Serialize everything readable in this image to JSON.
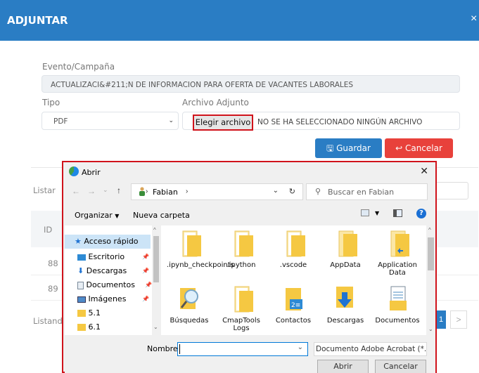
{
  "modal": {
    "title": "ADJUNTAR",
    "close": "×"
  },
  "form": {
    "evento_label": "Evento/Campaña",
    "evento_value": "ACTUALIZACI&#211;N DE INFORMACION PARA OFERTA DE VACANTES LABORALES",
    "tipo_label": "Tipo",
    "tipo_value": "PDF",
    "archivo_label": "Archivo Adjunto",
    "choose_file": "Elegir archivo",
    "no_file": "NO SE HA SELECCIONADO NINGÚN ARCHIVO",
    "save": "Guardar",
    "cancel": "Cancelar"
  },
  "background": {
    "listar": "Listar",
    "id_header": "ID",
    "rows": [
      "88",
      "89"
    ],
    "listando": "Listand",
    "page": "1",
    "next": ">"
  },
  "dialog": {
    "title": "Abrir",
    "close": "✕",
    "path_folder": "Fabian",
    "search_placeholder": "Buscar en Fabian",
    "organize": "Organizar",
    "new_folder": "Nueva carpeta",
    "nav_items": [
      {
        "label": "Acceso rápido"
      },
      {
        "label": "Escritorio"
      },
      {
        "label": "Descargas"
      },
      {
        "label": "Documentos"
      },
      {
        "label": "Imágenes"
      },
      {
        "label": "5.1"
      },
      {
        "label": "6.1"
      }
    ],
    "files": [
      {
        "name": ".ipynb_checkpoints",
        "icon": "folder-doc-icon"
      },
      {
        "name": ".ipython",
        "icon": "folder-doc-icon"
      },
      {
        "name": ".vscode",
        "icon": "folder-doc-icon"
      },
      {
        "name": "AppData",
        "icon": "folder-icon"
      },
      {
        "name": "Application Data",
        "icon": "folder-shortcut-icon"
      },
      {
        "name": "Búsquedas",
        "icon": "search-folder-icon"
      },
      {
        "name": "CmapTools Logs",
        "icon": "folder-doc-icon"
      },
      {
        "name": "Contactos",
        "icon": "contacts-folder-icon"
      },
      {
        "name": "Descargas",
        "icon": "downloads-folder-icon"
      },
      {
        "name": "Documentos",
        "icon": "documents-folder-icon"
      }
    ],
    "file_name_label": "Nombre:",
    "file_name_value": "",
    "file_type": "Documento Adobe Acrobat (*.pdf)",
    "open": "Abrir",
    "cancel": "Cancelar"
  },
  "colors": {
    "primary": "#2a7dc4",
    "danger": "#e8413b",
    "highlight": "#d0131b",
    "folder": "#f5c842"
  }
}
